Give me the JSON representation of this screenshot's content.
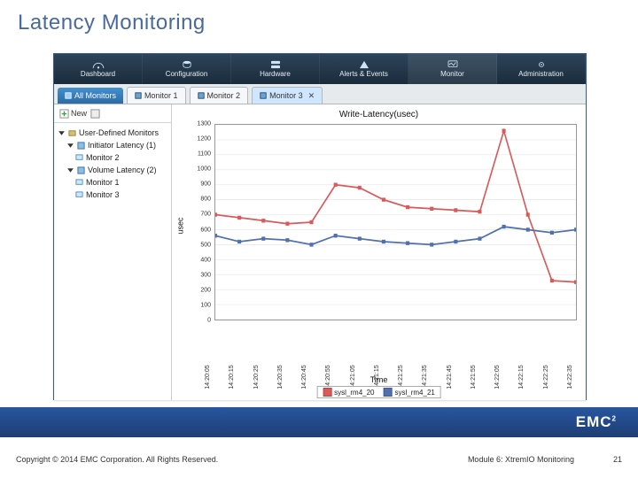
{
  "slide": {
    "title": "Latency Monitoring",
    "copyright": "Copyright © 2014 EMC Corporation. All Rights Reserved.",
    "module": "Module 6: XtremIO Monitoring",
    "page": "21",
    "brand": "EMC",
    "brand_sup": "2"
  },
  "menubar": {
    "items": [
      {
        "label": "Dashboard"
      },
      {
        "label": "Configuration"
      },
      {
        "label": "Hardware"
      },
      {
        "label": "Alerts & Events"
      },
      {
        "label": "Monitor",
        "selected": true
      },
      {
        "label": "Administration"
      }
    ]
  },
  "tabs": {
    "all_label": "All Monitors",
    "work": [
      {
        "label": "Monitor 1",
        "active": false
      },
      {
        "label": "Monitor 2",
        "active": false
      },
      {
        "label": "Monitor 3",
        "active": true
      }
    ]
  },
  "sidebar": {
    "new_label": "New",
    "tree": [
      {
        "label": "User-Defined Monitors",
        "level": 0,
        "icon": "folder"
      },
      {
        "label": "Initiator Latency (1)",
        "level": 1,
        "icon": "group"
      },
      {
        "label": "Monitor 2",
        "level": 2,
        "icon": "monitor"
      },
      {
        "label": "Volume Latency (2)",
        "level": 1,
        "icon": "group"
      },
      {
        "label": "Monitor 1",
        "level": 2,
        "icon": "monitor"
      },
      {
        "label": "Monitor 3",
        "level": 2,
        "icon": "monitor"
      }
    ]
  },
  "chart_data": {
    "type": "line",
    "title": "Write-Latency(usec)",
    "xlabel": "Time",
    "ylabel": "usec",
    "ylim": [
      0,
      1300
    ],
    "yticks": [
      0,
      100,
      200,
      300,
      400,
      500,
      600,
      700,
      800,
      900,
      1000,
      1100,
      1200,
      1300
    ],
    "categories": [
      "14:20:05",
      "14:20:15",
      "14:20:25",
      "14:20:35",
      "14:20:45",
      "14:20:55",
      "14:21:05",
      "14:21:15",
      "14:21:25",
      "14:21:35",
      "14:21:45",
      "14:21:55",
      "14:22:05",
      "14:22:15",
      "14:22:25",
      "14:22:35"
    ],
    "series": [
      {
        "name": "sysl_rm4_20",
        "color": "#d85a5a",
        "values": [
          700,
          680,
          660,
          640,
          650,
          900,
          880,
          800,
          750,
          740,
          730,
          720,
          1260,
          700,
          260,
          250
        ]
      },
      {
        "name": "sysl_rm4_21",
        "color": "#5070b0",
        "values": [
          560,
          520,
          540,
          530,
          500,
          560,
          540,
          520,
          510,
          500,
          520,
          540,
          620,
          600,
          580,
          600
        ]
      }
    ]
  }
}
